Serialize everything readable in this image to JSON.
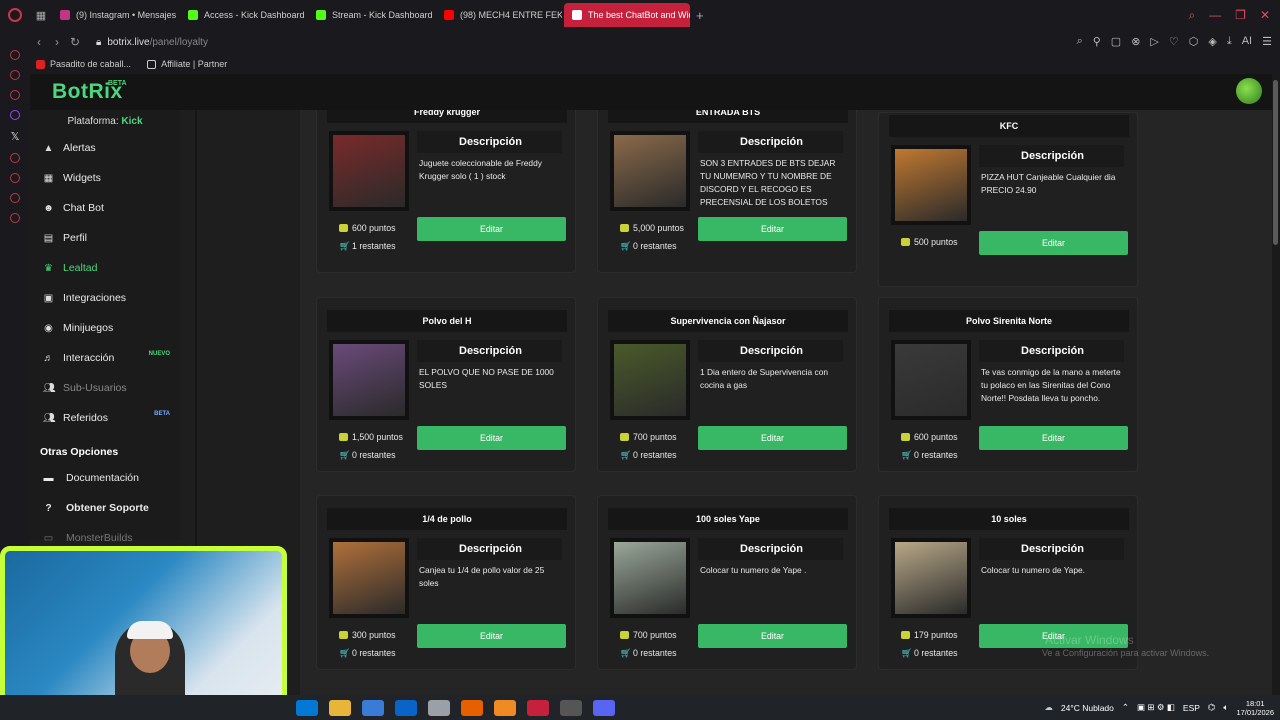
{
  "browser": {
    "tabs": [
      {
        "label": "(9) Instagram • Mensajes",
        "color": "#c13584"
      },
      {
        "label": "Access - Kick Dashboard",
        "color": "#53fc18"
      },
      {
        "label": "Stream - Kick Dashboard",
        "color": "#53fc18"
      },
      {
        "label": "(98) MECH4 ENTRE FEKA",
        "color": "#ff0000"
      },
      {
        "label": "The best ChatBot and Wid",
        "color": "#ffffff"
      }
    ],
    "url_host": "botrix.live",
    "url_path": "/panel/loyalty",
    "bookmarks": [
      "Pasadito de caball...",
      "Affiliate | Partner"
    ],
    "ai_label": "AI"
  },
  "app": {
    "logo": "BotRix",
    "logo_badge": "BETA",
    "platform_label": "Plataforma:",
    "platform_value": "Kick"
  },
  "sidebar": {
    "items": [
      {
        "label": "Alertas",
        "icon": "warning-icon"
      },
      {
        "label": "Widgets",
        "icon": "grid-icon"
      },
      {
        "label": "Chat Bot",
        "icon": "robot-icon"
      },
      {
        "label": "Perfil",
        "icon": "profile-card-icon"
      },
      {
        "label": "Lealtad",
        "icon": "trophy-icon"
      },
      {
        "label": "Integraciones",
        "icon": "list-icon"
      },
      {
        "label": "Minijuegos",
        "icon": "gamepad-icon"
      },
      {
        "label": "Interacción",
        "icon": "music-icon",
        "badge": "NUEVO"
      },
      {
        "label": "Sub-Usuarios",
        "icon": "users-icon"
      },
      {
        "label": "Referidos",
        "icon": "users-icon",
        "badge": "BETA"
      }
    ],
    "other_title": "Otras Opciones",
    "other_items": [
      {
        "label": "Documentación",
        "icon": "book-icon"
      },
      {
        "label": "Obtener Soporte",
        "icon": "help-icon"
      },
      {
        "label": "MonsterBuilds",
        "icon": "monitor-icon"
      }
    ]
  },
  "rewards": {
    "desc_heading": "Descripción",
    "edit_label": "Editar",
    "items": [
      {
        "title": "Freddy krugger",
        "description": "Juguete coleccionable de Freddy Krugger solo ( 1 ) stock",
        "points": "600 puntos",
        "remaining": "1 restantes",
        "thumb_color": "#7a2a2a"
      },
      {
        "title": "ENTRADA BTS",
        "description": "SON 3 ENTRADES DE BTS DEJAR TU NUMEMRO Y TU NOMBRE DE DISCORD Y EL RECOGO ES PRECENSIAL DE LOS BOLETOS",
        "points": "5,000 puntos",
        "remaining": "0 restantes",
        "thumb_color": "#8a6a4a"
      },
      {
        "title": "KFC",
        "description": "PIZZA HUT Canjeable Cualquier dia PRECIO 24.90",
        "points": "500 puntos",
        "remaining": "",
        "thumb_color": "#c07830"
      },
      {
        "title": "Polvo del H",
        "description": "EL POLVO QUE NO PASE DE 1000 SOLES",
        "points": "1,500 puntos",
        "remaining": "0 restantes",
        "thumb_color": "#6a4a7a"
      },
      {
        "title": "Supervivencia con Ñajasor",
        "description": "1 Dia entero de Supervivencia con cocina a gas",
        "points": "700 puntos",
        "remaining": "0 restantes",
        "thumb_color": "#4a5a2a"
      },
      {
        "title": "Polvo Sirenita Norte",
        "description": "Te vas conmigo de la mano a meterte tu polaco en las Sirenitas del Cono Norte!! Posdata lleva tu poncho.",
        "points": "600 puntos",
        "remaining": "0 restantes",
        "thumb_color": "#3a3a3a"
      },
      {
        "title": "1/4 de pollo",
        "description": "Canjea tu 1/4 de pollo valor de 25 soles",
        "points": "300 puntos",
        "remaining": "0 restantes",
        "thumb_color": "#b0703a"
      },
      {
        "title": "100 soles Yape",
        "description": "Colocar tu numero de Yape .",
        "points": "700 puntos",
        "remaining": "0 restantes",
        "thumb_color": "#9aa89a"
      },
      {
        "title": "10 soles",
        "description": "Colocar tu numero de Yape.",
        "points": "179 puntos",
        "remaining": "0 restantes",
        "thumb_color": "#b8a888"
      }
    ]
  },
  "os": {
    "watermark_title": "Activar Windows",
    "watermark_sub": "Ve a Configuración para activar Windows.",
    "weather": "24°C  Nublado",
    "lang": "ESP",
    "time": "18:01",
    "date": "17/01/2026"
  },
  "colors": {
    "accent": "#4cd77f",
    "edit_button": "#38b864",
    "active_tab": "#c5213c"
  }
}
